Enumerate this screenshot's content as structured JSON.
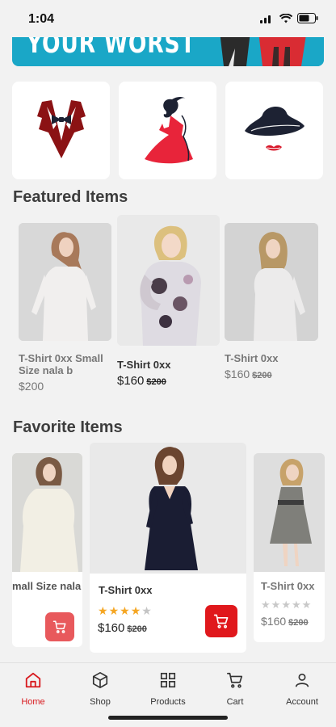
{
  "status": {
    "time": "1:04"
  },
  "banner": {
    "text": "YOUR WORST"
  },
  "categories": [
    {
      "icon": "tuxedo-icon"
    },
    {
      "icon": "dress-icon"
    },
    {
      "icon": "hat-icon"
    }
  ],
  "featured": {
    "title": "Featured Items",
    "items": [
      {
        "name": "T-Shirt 0xx Small Size nala b",
        "price": "$200",
        "old_price": ""
      },
      {
        "name": "T-Shirt 0xx",
        "price": "$160",
        "old_price": "$200"
      },
      {
        "name": "T-Shirt 0xx",
        "price": "$160",
        "old_price": "$200"
      }
    ]
  },
  "favorites": {
    "title": "Favorite Items",
    "items": [
      {
        "name": "mall Size nala",
        "price": "",
        "old_price": "",
        "rating": 0
      },
      {
        "name": "T-Shirt 0xx",
        "price": "$160",
        "old_price": "$200",
        "rating": 4
      },
      {
        "name": "T-Shirt 0xx",
        "price": "$160",
        "old_price": "$200",
        "rating": 0
      }
    ]
  },
  "colors": {
    "accent": "#e0181c",
    "star": "#f5a623",
    "banner": "#1aa7c7"
  },
  "tabs": [
    {
      "label": "Home",
      "icon": "home-icon"
    },
    {
      "label": "Shop",
      "icon": "box-icon"
    },
    {
      "label": "Products",
      "icon": "grid-icon"
    },
    {
      "label": "Cart",
      "icon": "cart-icon"
    },
    {
      "label": "Account",
      "icon": "user-icon"
    }
  ]
}
